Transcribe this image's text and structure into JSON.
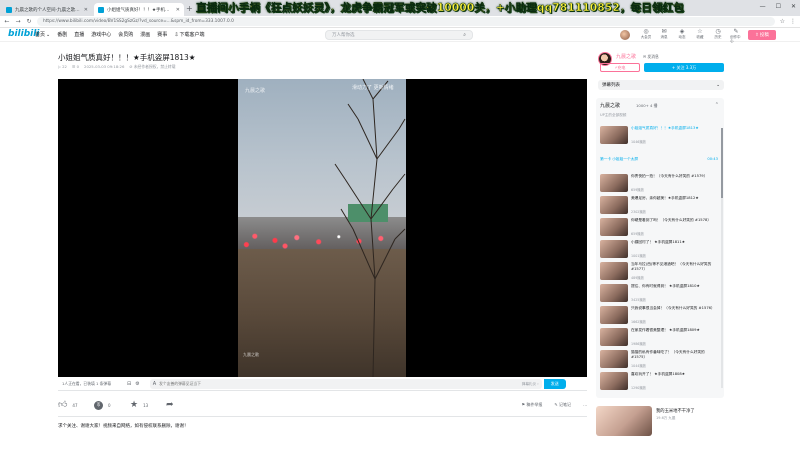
{
  "browser": {
    "tabs": [
      {
        "label": "九晨之歌的个人空间-九晨之歌个人...",
        "active": false
      },
      {
        "label": "小姐姐气质真好！！！★手机...",
        "active": true
      }
    ],
    "url": "https://www.bilibili.com/video/BV1SS2gSzGz/?vd_source=...&spm_id_from=333.1007.0.0",
    "banner": "直播间小手柄《狂点妖妖灵》，龙虎争霸冠军或突破10000关，+小助理qq781110852，每日领红包"
  },
  "header": {
    "logo": "bilibili",
    "nav": [
      "首页",
      "番剧",
      "直播",
      "游戏中心",
      "会员购",
      "漫画",
      "赛事",
      "下载客户端"
    ],
    "search_placeholder": "万人帮你选",
    "icons": [
      {
        "name": "big-member-icon",
        "glyph": "◎",
        "label": "大会员"
      },
      {
        "name": "message-icon",
        "glyph": "✉",
        "label": "消息"
      },
      {
        "name": "dynamic-icon",
        "glyph": "◈",
        "label": "动态"
      },
      {
        "name": "favorite-icon",
        "glyph": "☆",
        "label": "收藏"
      },
      {
        "name": "history-icon",
        "glyph": "◷",
        "label": "历史"
      },
      {
        "name": "creation-icon",
        "glyph": "✎",
        "label": "创作中心"
      }
    ],
    "upload": "投稿"
  },
  "video": {
    "title": "小姐姐气质真好！！！★手机盗屏1813★",
    "views": "22",
    "danmaku": "0",
    "date": "2025-03-03 09:18:26",
    "warning": "未经作者授权，禁止转载",
    "watermark_left": "九晨之歌",
    "watermark_top": "滑动力了 更新情绪",
    "watermark_bottom": "九晨之歌"
  },
  "danmaku_bar": {
    "info": "1人正在看，已装填 1 条弹幕",
    "placeholder": "发个友善的弹幕见证当下",
    "etiquette": "弹幕礼仪 ›",
    "send": "发送"
  },
  "actions": {
    "like": "47",
    "coin": "0",
    "favorite": "13",
    "share": "",
    "report": "稿件举报",
    "notes": "记笔记"
  },
  "description": "求个关注、谢谢大家！视频来自网络，如有侵权联系删除，谢谢！",
  "up": {
    "name": "九晨之歌",
    "message": "发消息",
    "charge": "充电",
    "follow": "+ 关注 3.3万"
  },
  "danmaku_list": {
    "label": "弹幕列表"
  },
  "collection": {
    "title": "九晨之歌",
    "count": "1000+ 4 播",
    "subtitle": "UP主的全部视频",
    "current_group": "第一卡 小姐姐一个太屏",
    "current_group_time": "00:43",
    "items": [
      {
        "title": "小姐姐气质真好！！！★手机盗屏1813★",
        "plays": "1046播放",
        "current": true
      },
      {
        "title": "你贵快拍一拍！（今天有什么好笑的 #1579）",
        "plays": "659播放"
      },
      {
        "title": "美爆足厉，亲你超美！★手机盗屏1812★",
        "plays": "2302播放"
      },
      {
        "title": "你硬是看到了吗！（今天有什么好笑的 #1578）",
        "plays": "659播放"
      },
      {
        "title": "小姨回村了！ ★手机盗屏1811★",
        "plays": "1001播放"
      },
      {
        "title": "当年马拉(西)等不见港酒吧！（今天有什么好笑的 #1577）",
        "plays": "489播放"
      },
      {
        "title": "提往、你有时就得到！ ★手机盗屏1810★",
        "plays": "3425播放"
      },
      {
        "title": "只我说事很当会掉！（今天有什么好笑的 #1576）",
        "plays": "1662播放"
      },
      {
        "title": "在家发作着很美整理！ ★手机盗屏1809★",
        "plays": "1986播放"
      },
      {
        "title": "猫猫的私有作番味吃了！（今天有什么好笑的 #1575）",
        "plays": "1044播放"
      },
      {
        "title": "喜欢玩开了！ ★手机盗屏1808★",
        "plays": "1290播放"
      }
    ]
  },
  "recommend": {
    "title": "我的玉米地不干净了",
    "stats": "19.6万  九晨"
  }
}
